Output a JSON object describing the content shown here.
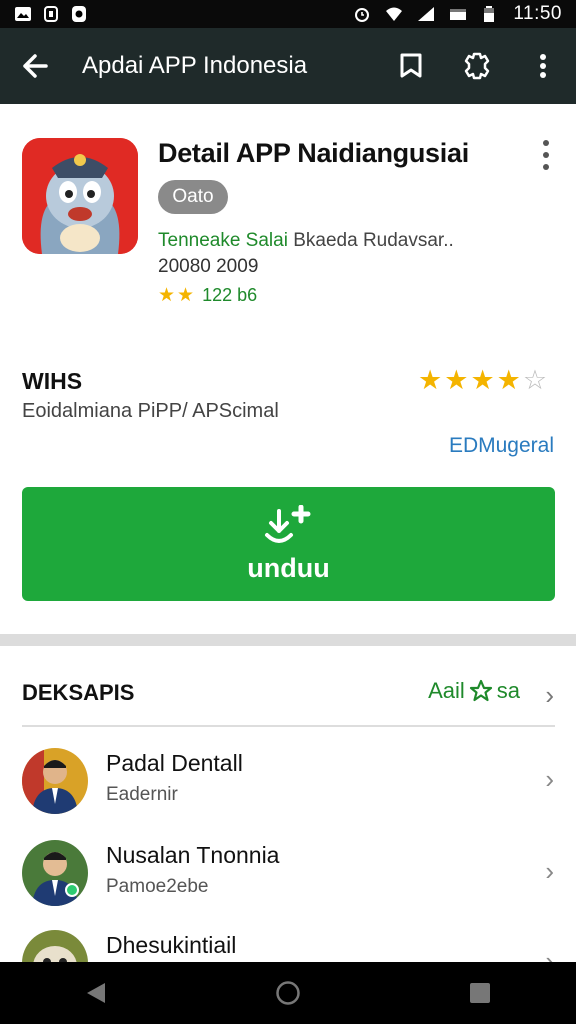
{
  "status_bar": {
    "time": "11:50"
  },
  "app_bar": {
    "title": "Apdai APP Indonesia"
  },
  "app": {
    "name": "Detail APP Naidiangusiai",
    "badge": "Oato",
    "developer_name": "Tenneake Salai",
    "developer_rest": "Bkaeda Rudavsar..",
    "date": "20080 2009",
    "small_rating_text": "122 b6",
    "small_rating_stars": 2
  },
  "rating_section": {
    "title": "WIHS",
    "subtitle": "Eoidalmiana PiPP/ APScimal",
    "link": "EDMugeral",
    "stars": 4,
    "max_stars": 5
  },
  "install_button": {
    "label": "unduu"
  },
  "list": {
    "header": "DEKSAPIS",
    "header_link": "Aail",
    "header_link_suffix": "sa",
    "items": [
      {
        "name": "Padal Dentall",
        "sub": "Eadernir"
      },
      {
        "name": "Nusalan Tnonnia",
        "sub": "Pamoe2ebe"
      },
      {
        "name": "Dhesukintiail",
        "sub": ""
      }
    ]
  },
  "colors": {
    "app_bar": "#1f2a2a",
    "accent_green": "#1ea83b",
    "link_blue": "#2a7bbf",
    "star_gold": "#f4b400"
  }
}
